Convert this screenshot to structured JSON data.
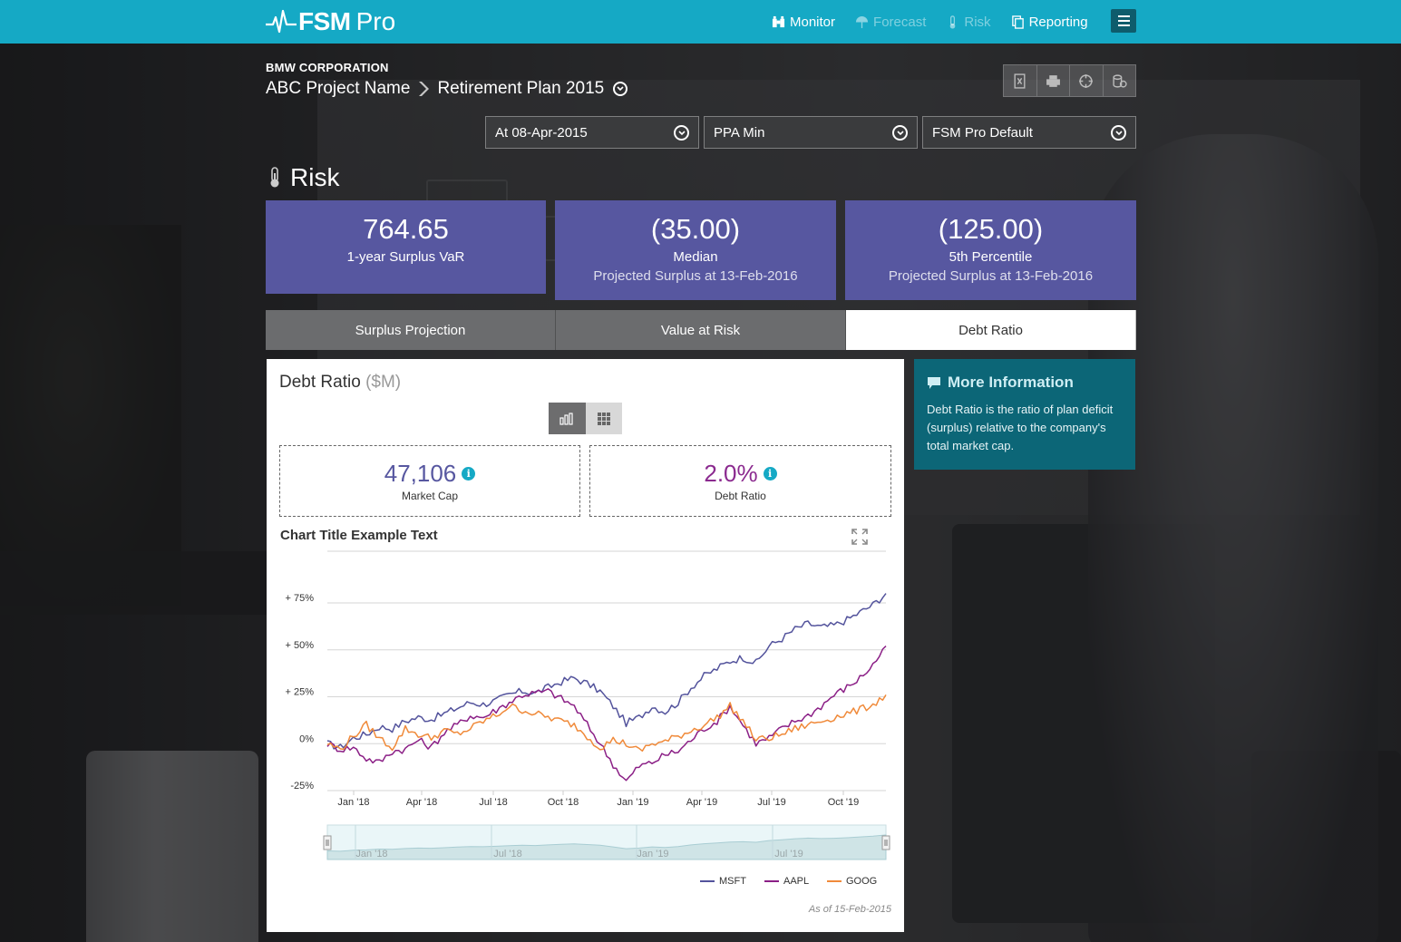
{
  "nav": {
    "logo_main": "FSM",
    "logo_sub": "Pro",
    "items": [
      {
        "label": "Monitor",
        "icon": "binoculars-icon",
        "state": "active"
      },
      {
        "label": "Forecast",
        "icon": "umbrella-icon",
        "state": "disabled"
      },
      {
        "label": "Risk",
        "icon": "thermometer-icon",
        "state": "disabled"
      },
      {
        "label": "Reporting",
        "icon": "copy-icon",
        "state": "active"
      }
    ]
  },
  "header": {
    "company": "BMW CORPORATION",
    "project": "ABC Project Name",
    "plan": "Retirement Plan 2015"
  },
  "selects": {
    "date": "At 08-Apr-2015",
    "basis": "PPA Min",
    "profile": "FSM Pro Default"
  },
  "page_title": "Risk",
  "kpis": [
    {
      "value": "764.65",
      "label": "1-year Surplus VaR",
      "sub": ""
    },
    {
      "value": "(35.00)",
      "label": "Median",
      "sub": "Projected Surplus at 13-Feb-2016"
    },
    {
      "value": "(125.00)",
      "label": "5th Percentile",
      "sub": "Projected Surplus at 13-Feb-2016"
    }
  ],
  "tabs": [
    "Surplus Projection",
    "Value at Risk",
    "Debt Ratio"
  ],
  "panel": {
    "title": "Debt Ratio",
    "unit": "($M)",
    "metrics": [
      {
        "value": "47,106",
        "label": "Market Cap",
        "color": "#5757a0"
      },
      {
        "value": "2.0%",
        "label": "Debt Ratio",
        "color": "#8b2a8f"
      }
    ],
    "chart_title": "Chart Title Example Text",
    "as_of": "As of 15-Feb-2015"
  },
  "info": {
    "title": "More Information",
    "body": "Debt Ratio is the ratio of plan deficit (surplus) relative to the company's total market cap."
  },
  "colors": {
    "brand": "#15a9c5",
    "kpi": "#5757a0",
    "msft": "#53539c",
    "aapl": "#8b1f86",
    "goog": "#f08a3a",
    "info": "#0c6677"
  },
  "chart_data": {
    "type": "line",
    "title": "Chart Title Example Text",
    "x_ticks": [
      "Jan '18",
      "Apr '18",
      "Jul '18",
      "Oct '18",
      "Jan '19",
      "Apr '19",
      "Jul '19",
      "Oct '19"
    ],
    "y_ticks": [
      "+ 75%",
      "+ 50%",
      "+ 25%",
      "0%",
      "-25%"
    ],
    "ylim": [
      -25,
      75
    ],
    "navigator_ticks": [
      "Jan '18",
      "Jul '18",
      "Jan '19",
      "Jul '19"
    ],
    "x_start": "2017-12",
    "x_end": "2019-12",
    "series": [
      {
        "name": "MSFT",
        "color": "#53539c",
        "values": [
          0,
          -2,
          3,
          5,
          9,
          8,
          12,
          14,
          13,
          16,
          19,
          22,
          21,
          23,
          26,
          28,
          27,
          30,
          33,
          35,
          32,
          28,
          20,
          11,
          14,
          20,
          17,
          22,
          30,
          36,
          40,
          44,
          46,
          43,
          52,
          56,
          61,
          64,
          62,
          63,
          66,
          70,
          74,
          80
        ]
      },
      {
        "name": "AAPL",
        "color": "#8b1f86",
        "values": [
          0,
          -3,
          -2,
          -8,
          -10,
          -4,
          -3,
          2,
          -2,
          6,
          10,
          15,
          14,
          18,
          22,
          26,
          27,
          28,
          24,
          20,
          10,
          0,
          -11,
          -20,
          -12,
          -10,
          -6,
          -4,
          2,
          8,
          12,
          20,
          10,
          0,
          3,
          8,
          12,
          15,
          20,
          26,
          30,
          35,
          42,
          52
        ]
      },
      {
        "name": "GOOG",
        "color": "#f08a3a",
        "values": [
          0,
          -3,
          4,
          10,
          3,
          -2,
          8,
          5,
          3,
          7,
          5,
          8,
          12,
          15,
          20,
          18,
          16,
          14,
          12,
          10,
          4,
          -2,
          2,
          0,
          -4,
          0,
          1,
          4,
          7,
          10,
          14,
          20,
          12,
          2,
          3,
          5,
          8,
          10,
          12,
          14,
          16,
          18,
          21,
          26
        ]
      }
    ]
  }
}
